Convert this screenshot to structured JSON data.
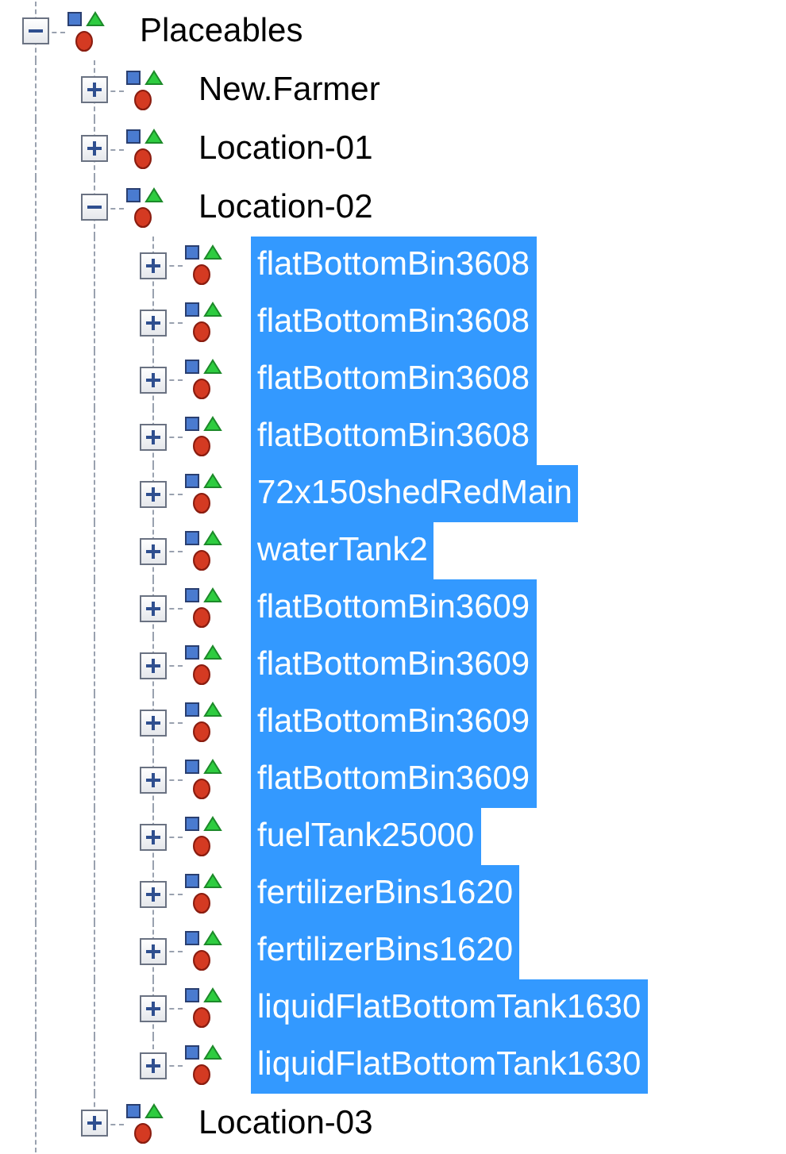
{
  "tree": [
    {
      "label": "Placeables",
      "expanded": true,
      "selected": false,
      "children": [
        {
          "label": "New.Farmer",
          "expanded": false,
          "selected": false
        },
        {
          "label": "Location-01",
          "expanded": false,
          "selected": false
        },
        {
          "label": "Location-02",
          "expanded": true,
          "selected": false,
          "children": [
            {
              "label": "flatBottomBin3608",
              "expanded": false,
              "selected": true
            },
            {
              "label": "flatBottomBin3608",
              "expanded": false,
              "selected": true
            },
            {
              "label": "flatBottomBin3608",
              "expanded": false,
              "selected": true
            },
            {
              "label": "flatBottomBin3608",
              "expanded": false,
              "selected": true
            },
            {
              "label": "72x150shedRedMain",
              "expanded": false,
              "selected": true
            },
            {
              "label": "waterTank2",
              "expanded": false,
              "selected": true
            },
            {
              "label": "flatBottomBin3609",
              "expanded": false,
              "selected": true
            },
            {
              "label": "flatBottomBin3609",
              "expanded": false,
              "selected": true
            },
            {
              "label": "flatBottomBin3609",
              "expanded": false,
              "selected": true
            },
            {
              "label": "flatBottomBin3609",
              "expanded": false,
              "selected": true
            },
            {
              "label": "fuelTank25000",
              "expanded": false,
              "selected": true
            },
            {
              "label": "fertilizerBins1620",
              "expanded": false,
              "selected": true
            },
            {
              "label": "fertilizerBins1620",
              "expanded": false,
              "selected": true
            },
            {
              "label": "liquidFlatBottomTank1630",
              "expanded": false,
              "selected": true
            },
            {
              "label": "liquidFlatBottomTank1630",
              "expanded": false,
              "selected": true
            }
          ]
        },
        {
          "label": "Location-03",
          "expanded": false,
          "selected": false
        }
      ]
    }
  ]
}
